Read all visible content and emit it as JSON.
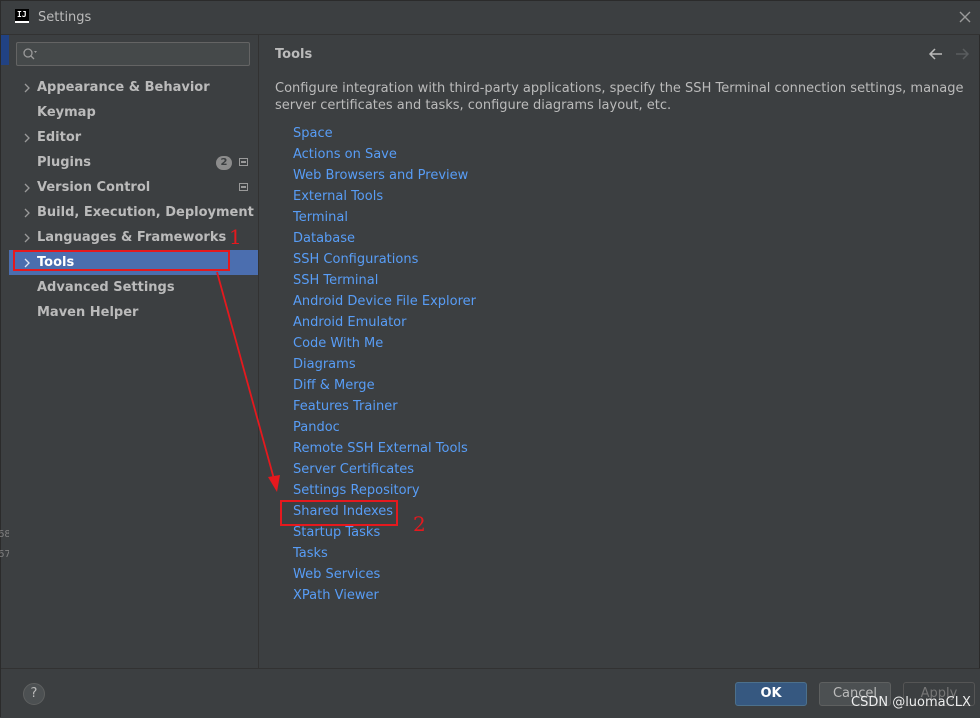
{
  "window": {
    "title": "Settings",
    "app_icon_text": "IJ"
  },
  "edge_numbers": [
    "68",
    "67"
  ],
  "search": {
    "placeholder": "",
    "value": ""
  },
  "sidebar": {
    "items": [
      {
        "label": "Appearance & Behavior",
        "expandable": true
      },
      {
        "label": "Keymap",
        "expandable": false
      },
      {
        "label": "Editor",
        "expandable": true
      },
      {
        "label": "Plugins",
        "expandable": false,
        "badge": "2"
      },
      {
        "label": "Version Control",
        "expandable": true
      },
      {
        "label": "Build, Execution, Deployment",
        "expandable": true
      },
      {
        "label": "Languages & Frameworks",
        "expandable": true
      },
      {
        "label": "Tools",
        "expandable": true,
        "selected": true
      },
      {
        "label": "Advanced Settings",
        "expandable": false
      },
      {
        "label": "Maven Helper",
        "expandable": false
      }
    ]
  },
  "content": {
    "title": "Tools",
    "description": "Configure integration with third-party applications, specify the SSH Terminal connection settings, manage server certificates and tasks, configure diagrams layout, etc.",
    "links": [
      "Space",
      "Actions on Save",
      "Web Browsers and Preview",
      "External Tools",
      "Terminal",
      "Database",
      "SSH Configurations",
      "SSH Terminal",
      "Android Device File Explorer",
      "Android Emulator",
      "Code With Me",
      "Diagrams",
      "Diff & Merge",
      "Features Trainer",
      "Pandoc",
      "Remote SSH External Tools",
      "Server Certificates",
      "Settings Repository",
      "Shared Indexes",
      "Startup Tasks",
      "Tasks",
      "Web Services",
      "XPath Viewer"
    ]
  },
  "buttons": {
    "help": "?",
    "ok": "OK",
    "cancel": "Cancel",
    "apply": "Apply"
  },
  "watermark": "CSDN @luomaCLX",
  "annotations": {
    "label_1": "1",
    "label_2": "2"
  },
  "colors": {
    "background": "#3c3f41",
    "selection": "#4b6eaf",
    "link": "#589df6",
    "annotation": "#e5191e",
    "ok_button": "#365880"
  }
}
